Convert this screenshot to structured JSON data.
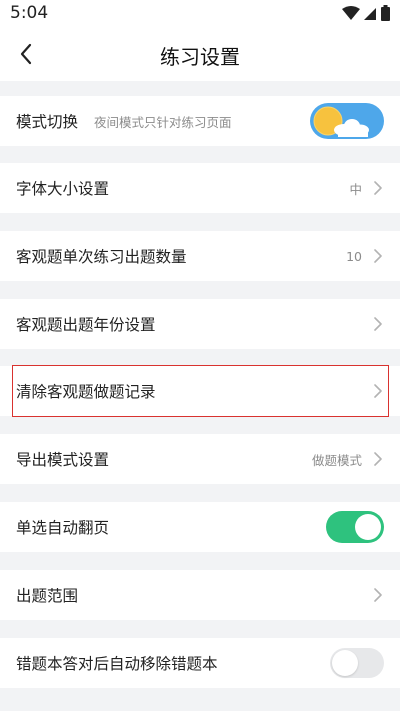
{
  "status_bar": {
    "time": "5:04"
  },
  "header": {
    "title": "练习设置"
  },
  "settings": {
    "mode_switch": {
      "label": "模式切换",
      "description": "夜间模式只针对练习页面"
    },
    "font_size": {
      "label": "字体大小设置",
      "value": "中"
    },
    "objective_count": {
      "label": "客观题单次练习出题数量",
      "value": "10"
    },
    "objective_year": {
      "label": "客观题出题年份设置"
    },
    "clear_records": {
      "label": "清除客观题做题记录"
    },
    "export_mode": {
      "label": "导出模式设置",
      "value": "做题模式"
    },
    "auto_page": {
      "label": "单选自动翻页",
      "state": "on"
    },
    "question_scope": {
      "label": "出题范围"
    },
    "auto_remove_wrong": {
      "label": "错题本答对后自动移除错题本",
      "state": "off"
    }
  },
  "colors": {
    "accent_green": "#2ec27e",
    "highlight_red": "#d9322f",
    "day_sky_blue": "#4ea7ea",
    "sun_yellow": "#f7c23e"
  },
  "icons": [
    "back-arrow-icon",
    "chevron-right-icon",
    "wifi-icon",
    "signal-icon",
    "battery-icon",
    "sun-icon",
    "cloud-icon"
  ]
}
